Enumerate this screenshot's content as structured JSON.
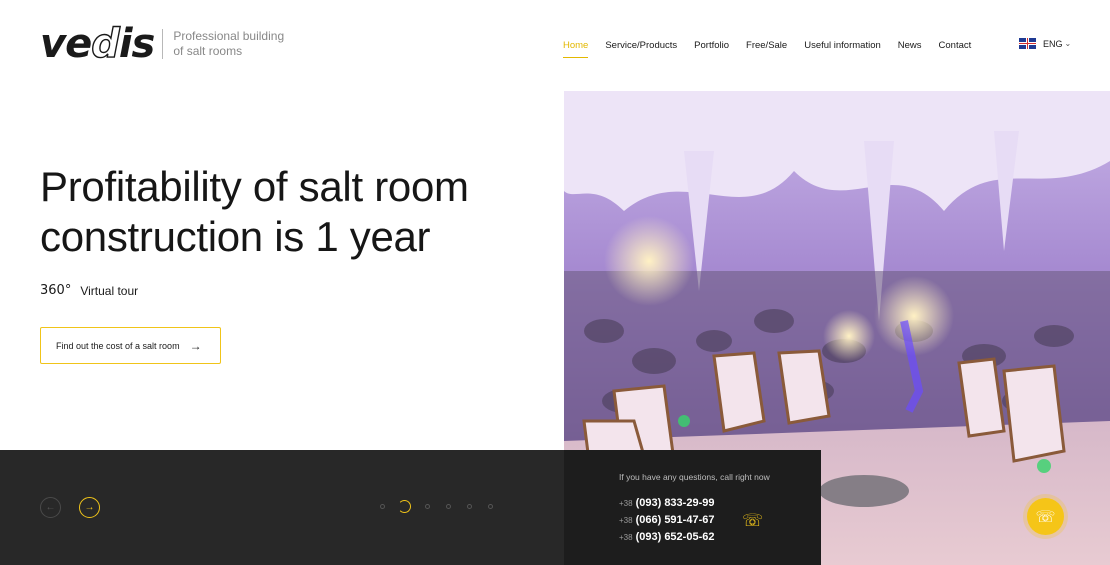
{
  "brand": {
    "logo_text_pre": "ve",
    "logo_text_o": "d",
    "logo_text_post": "is",
    "tagline": "Professional building of salt rooms"
  },
  "nav": {
    "items": [
      {
        "label": "Home",
        "active": true
      },
      {
        "label": "Service/Products"
      },
      {
        "label": "Portfolio"
      },
      {
        "label": "Free/Sale"
      },
      {
        "label": "Useful information"
      },
      {
        "label": "News"
      },
      {
        "label": "Contact"
      }
    ],
    "language": "ENG"
  },
  "hero": {
    "title": "Profitability of salt room construction is 1 year",
    "tour_icon": "360°",
    "tour_label": "Virtual tour",
    "cta_label": "Find out the cost of a salt room",
    "cta_arrow": "→"
  },
  "slider": {
    "prev_icon": "←",
    "next_icon": "→",
    "dot_count": 6,
    "active_dot": 1
  },
  "contacts": {
    "question": "If you have any questions, call right now",
    "phones": [
      {
        "cc": "+38",
        "number": "(093) 833-29-99"
      },
      {
        "cc": "+38",
        "number": "(066) 591-47-67"
      },
      {
        "cc": "+38",
        "number": "(093) 652-05-62"
      }
    ]
  },
  "colors": {
    "accent": "#f0c419",
    "dark": "#282828",
    "text": "#161616"
  }
}
